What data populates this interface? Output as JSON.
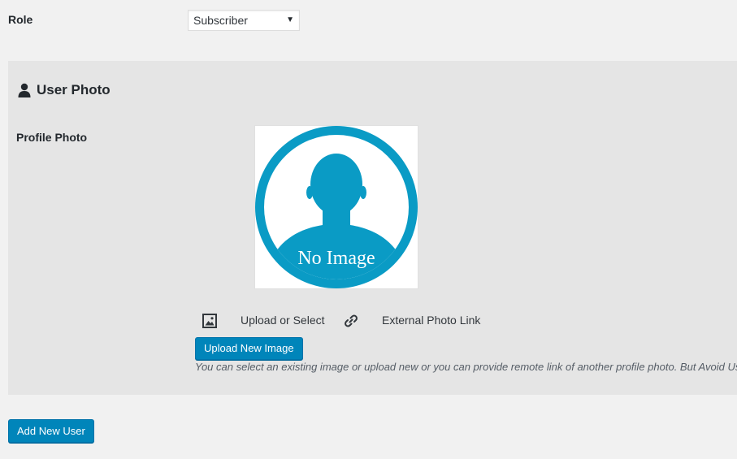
{
  "role": {
    "label": "Role",
    "selected": "Subscriber"
  },
  "user_photo": {
    "title": "User Photo",
    "title_icon": "user-icon",
    "profile_label": "Profile Photo",
    "placeholder_text": "No Image",
    "placeholder_color": "#0a9bc5",
    "tabs": [
      {
        "icon": "image-icon",
        "label": "Upload or Select"
      },
      {
        "icon": "link-icon",
        "label": "External Photo Link"
      }
    ],
    "upload_button_label": "Upload New Image",
    "help_text": "You can select an existing image or upload new or you can provide remote link of another profile photo. But Avoid Us"
  },
  "add_user_button_label": "Add New User",
  "colors": {
    "primary_button": "#0085ba",
    "panel_bg": "#e5e5e5",
    "page_bg": "#f1f1f1"
  }
}
